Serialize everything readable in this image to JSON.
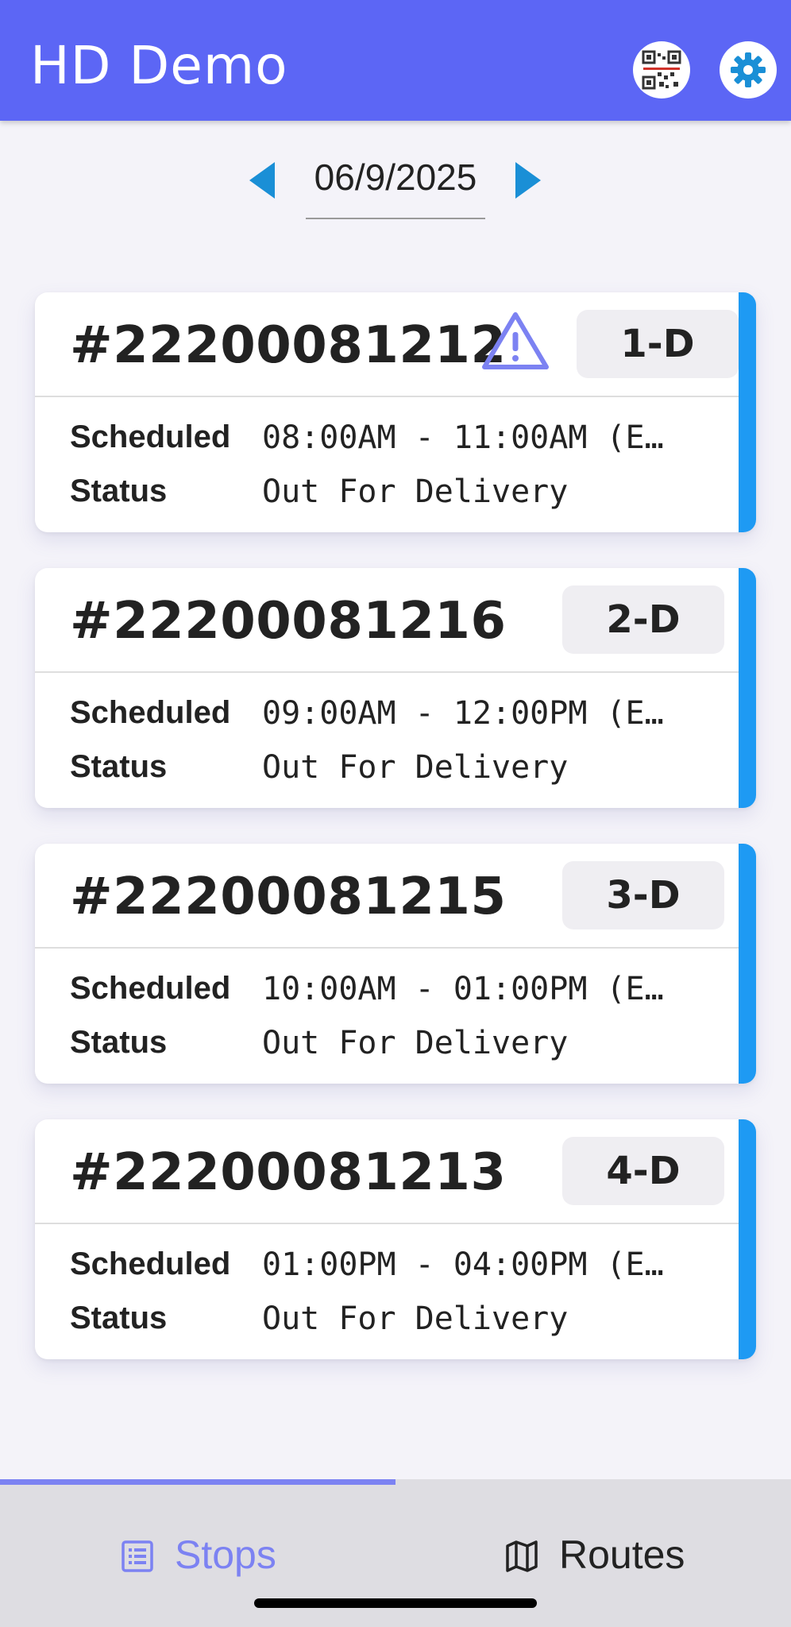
{
  "header": {
    "title": "HD Demo",
    "qr_icon": "qr-code-icon",
    "settings_icon": "gear-icon",
    "brand_color": "#5c66f5"
  },
  "date_nav": {
    "date": "06/9/2025",
    "prev_icon": "arrow-left-icon",
    "next_icon": "arrow-right-icon",
    "arrow_color": "#1a8fd6"
  },
  "stops": [
    {
      "order": "#22200081212",
      "badge": "1-D",
      "warning": true,
      "scheduled_label": "Scheduled",
      "scheduled": "08:00AM - 11:00AM (E…",
      "status_label": "Status",
      "status": "Out For Delivery"
    },
    {
      "order": "#22200081216",
      "badge": "2-D",
      "warning": false,
      "scheduled_label": "Scheduled",
      "scheduled": "09:00AM - 12:00PM (E…",
      "status_label": "Status",
      "status": "Out For Delivery"
    },
    {
      "order": "#22200081215",
      "badge": "3-D",
      "warning": false,
      "scheduled_label": "Scheduled",
      "scheduled": "10:00AM - 01:00PM (E…",
      "status_label": "Status",
      "status": "Out For Delivery"
    },
    {
      "order": "#22200081213",
      "badge": "4-D",
      "warning": false,
      "scheduled_label": "Scheduled",
      "scheduled": "01:00PM - 04:00PM (E…",
      "status_label": "Status",
      "status": "Out For Delivery"
    }
  ],
  "bottom_nav": {
    "tabs": [
      {
        "label": "Stops",
        "icon": "list-icon",
        "active": true
      },
      {
        "label": "Routes",
        "icon": "map-icon",
        "active": false
      }
    ],
    "active_color": "#7c82f2"
  },
  "colors": {
    "stripe": "#1e9af3",
    "warning": "#7c82f2"
  }
}
